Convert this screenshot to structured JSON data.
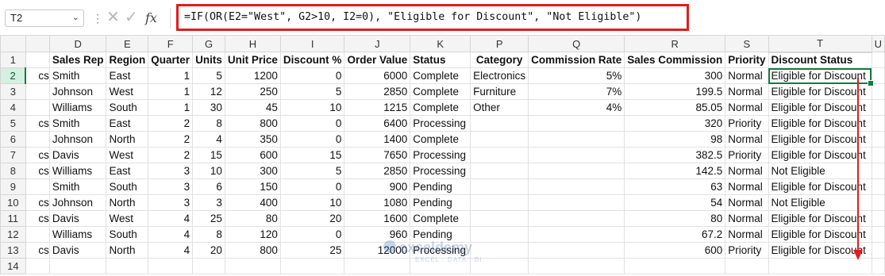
{
  "formula_bar": {
    "name_box": "T2",
    "cancel_glyph": "✕",
    "enter_glyph": "✓",
    "fx_label": "fx",
    "formula": "=IF(OR(E2=\"West\", G2>10, I2=0), \"Eligible for Discount\", \"Not Eligible\")"
  },
  "columns": [
    "D",
    "E",
    "F",
    "G",
    "H",
    "I",
    "J",
    "K",
    "P",
    "Q",
    "R",
    "S",
    "T",
    "U"
  ],
  "row_numbers": [
    "1",
    "2",
    "3",
    "4",
    "5",
    "6",
    "7",
    "8",
    "9",
    "10",
    "11",
    "12",
    "13",
    "14"
  ],
  "truncated_col_fragments": [
    "",
    "cs",
    "",
    "",
    "cs",
    "",
    "cs",
    "cs",
    "",
    "cs",
    "cs",
    "",
    "cs",
    ""
  ],
  "headers": [
    "Sales Rep",
    "Region",
    "Quarter",
    "Units",
    "Unit Price",
    "Discount %",
    "Order Value",
    "Status",
    "Category",
    "Commission Rate",
    "Sales Commission",
    "Priority",
    "Discount Status",
    ""
  ],
  "rows": [
    [
      "Smith",
      "East",
      "1",
      "5",
      "1200",
      "0",
      "6000",
      "Complete",
      "Electronics",
      "5%",
      "300",
      "Normal",
      "Eligible for Discount",
      ""
    ],
    [
      "Johnson",
      "West",
      "1",
      "12",
      "250",
      "5",
      "2850",
      "Complete",
      "Furniture",
      "7%",
      "199.5",
      "Normal",
      "Eligible for Discount",
      ""
    ],
    [
      "Williams",
      "South",
      "1",
      "30",
      "45",
      "10",
      "1215",
      "Complete",
      "Other",
      "4%",
      "85.05",
      "Normal",
      "Eligible for Discount",
      ""
    ],
    [
      "Smith",
      "East",
      "2",
      "8",
      "800",
      "0",
      "6400",
      "Processing",
      "",
      "",
      "320",
      "Priority",
      "Eligible for Discount",
      ""
    ],
    [
      "Johnson",
      "North",
      "2",
      "4",
      "350",
      "0",
      "1400",
      "Complete",
      "",
      "",
      "98",
      "Normal",
      "Eligible for Discount",
      ""
    ],
    [
      "Davis",
      "West",
      "2",
      "15",
      "600",
      "15",
      "7650",
      "Processing",
      "",
      "",
      "382.5",
      "Priority",
      "Eligible for Discount",
      ""
    ],
    [
      "Williams",
      "East",
      "3",
      "10",
      "300",
      "5",
      "2850",
      "Processing",
      "",
      "",
      "142.5",
      "Normal",
      "Not Eligible",
      ""
    ],
    [
      "Smith",
      "South",
      "3",
      "6",
      "150",
      "0",
      "900",
      "Pending",
      "",
      "",
      "63",
      "Normal",
      "Eligible for Discount",
      ""
    ],
    [
      "Johnson",
      "North",
      "3",
      "3",
      "400",
      "10",
      "1080",
      "Pending",
      "",
      "",
      "54",
      "Normal",
      "Not Eligible",
      ""
    ],
    [
      "Davis",
      "West",
      "4",
      "25",
      "80",
      "20",
      "1600",
      "Complete",
      "",
      "",
      "80",
      "Normal",
      "Eligible for Discount",
      ""
    ],
    [
      "Williams",
      "South",
      "4",
      "8",
      "120",
      "0",
      "960",
      "Pending",
      "",
      "",
      "67.2",
      "Normal",
      "Eligible for Discount",
      ""
    ],
    [
      "Davis",
      "North",
      "4",
      "20",
      "800",
      "25",
      "12000",
      "Processing",
      "",
      "",
      "600",
      "Priority",
      "Eligible for Discount",
      ""
    ],
    [
      "",
      "",
      "",
      "",
      "",
      "",
      "",
      "",
      "",
      "",
      "",
      "",
      "",
      ""
    ]
  ],
  "watermark": {
    "name": "exceldemy",
    "tagline": "EXCEL · DATA · BI"
  },
  "colors": {
    "accent_red": "#e11d1d",
    "excel_green": "#107c41",
    "selection_fill": "#d3f0e0"
  }
}
